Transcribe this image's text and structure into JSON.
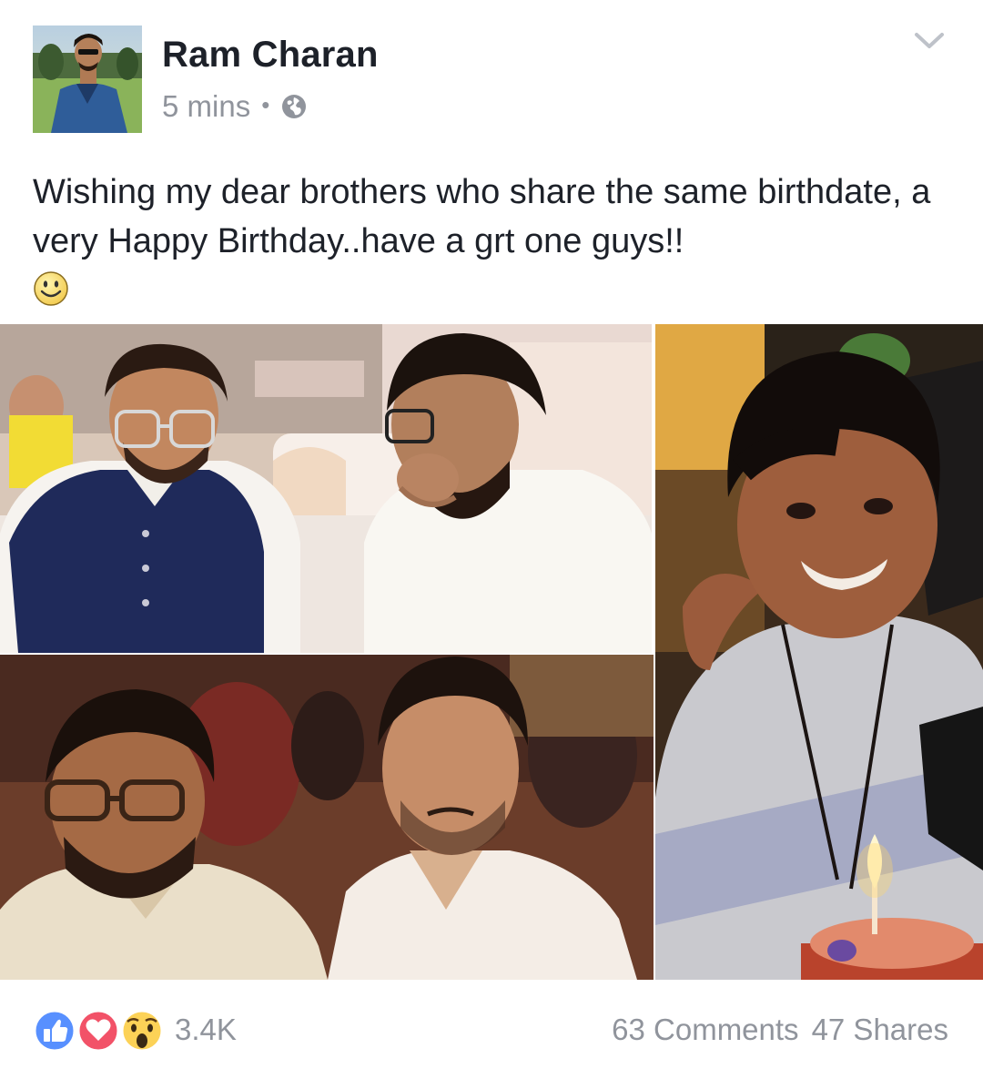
{
  "post": {
    "author": "Ram Charan",
    "time": "5 mins",
    "separator": "•",
    "privacy_icon": "globe-icon",
    "menu_icon": "chevron-down-icon",
    "text": "Wishing my dear brothers who share the same birthdate, a very Happy Birthday..have a grt one guys!!",
    "emoji": "smiley-emoji"
  },
  "photos": [
    {
      "name": "photo-two-men-glasses"
    },
    {
      "name": "photo-two-men-smiling"
    },
    {
      "name": "photo-boy-birthday-cake"
    }
  ],
  "footer": {
    "reaction_icons": [
      "like-icon",
      "love-icon",
      "wow-icon"
    ],
    "reaction_count": "3.4K",
    "comments": "63 Comments",
    "shares": "47 Shares"
  },
  "colors": {
    "text_primary": "#1d2129",
    "text_secondary": "#90949c",
    "like_blue": "#5890ff",
    "love_red": "#f25268",
    "wow_yellow": "#fcd257"
  }
}
